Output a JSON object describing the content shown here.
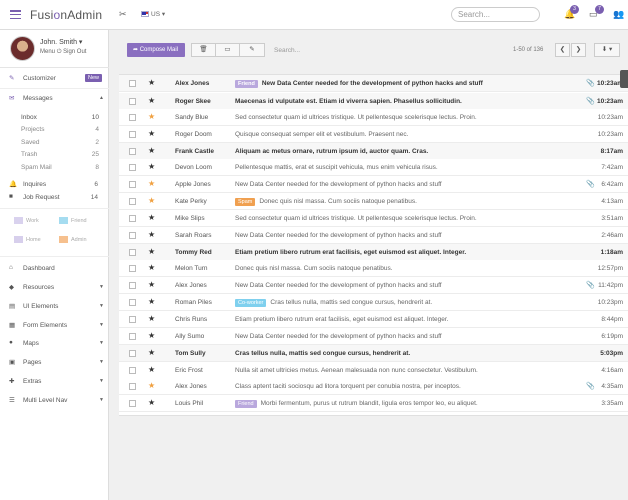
{
  "app": {
    "logo_prefix": "Fusi",
    "logo_accent": "o",
    "logo_suffix": "nAdmin",
    "accent_color": "#7a5fb0"
  },
  "topbar": {
    "language": "US",
    "search_placeholder": "Search...",
    "notifications_count": "3",
    "messages_count": "7"
  },
  "profile": {
    "name": "John. Smith",
    "menu": "Menu",
    "signout": "Sign Out"
  },
  "sidebar": {
    "customizer": "Customizer",
    "customizer_badge": "New",
    "messages": "Messages",
    "folders": [
      {
        "label": "Inbox",
        "count": "10"
      },
      {
        "label": "Projects",
        "count": "4"
      },
      {
        "label": "Saved",
        "count": "2"
      },
      {
        "label": "Trash",
        "count": "25"
      },
      {
        "label": "Spam Mail",
        "count": "8"
      }
    ],
    "inquires": {
      "label": "Inquires",
      "count": "6"
    },
    "job_request": {
      "label": "Job Request",
      "count": "14"
    },
    "labels": [
      {
        "label": "Work",
        "color": "#d9d2ee"
      },
      {
        "label": "Friend",
        "color": "#a5dcf0"
      },
      {
        "label": "Home",
        "color": "#d7cfec"
      },
      {
        "label": "Admin",
        "color": "#f6c08e"
      }
    ],
    "nav": [
      {
        "label": "Dashboard",
        "icon": "home-icon"
      },
      {
        "label": "Resources",
        "icon": "tag-icon"
      },
      {
        "label": "UI Elements",
        "icon": "layers-icon"
      },
      {
        "label": "Form Elements",
        "icon": "form-icon"
      },
      {
        "label": "Maps",
        "icon": "map-marker-icon"
      },
      {
        "label": "Pages",
        "icon": "pages-icon"
      },
      {
        "label": "Extras",
        "icon": "extras-icon"
      },
      {
        "label": "Multi Level Nav",
        "icon": "nav-icon"
      }
    ]
  },
  "mail": {
    "compose_label": "Compose Mail",
    "search_placeholder": "Search...",
    "pager": "1-50 of 136",
    "rows": [
      {
        "from": "Alex Jones",
        "tag": "Friend",
        "tag_color": "#b9a8dd",
        "subject": "New Data Center needed for the development of python hacks and stuff",
        "time": "10:23am",
        "unread": true,
        "starred": false,
        "attach": true
      },
      {
        "from": "Roger Skee",
        "tag": "",
        "subject": "Maecenas id vulputate est. Etiam id viverra sapien. Phasellus sollicitudin.",
        "time": "10:23am",
        "unread": true,
        "starred": false,
        "attach": true
      },
      {
        "from": "Sandy Blue",
        "tag": "",
        "subject": "Sed consectetur quam id ultrices tristique. Ut pellentesque scelerisque lectus. Proin.",
        "time": "10:23am",
        "unread": false,
        "starred": true,
        "attach": false
      },
      {
        "from": "Roger Doom",
        "tag": "",
        "subject": "Quisque consequat semper elit et vestibulum. Praesent nec.",
        "time": "10:23am",
        "unread": false,
        "starred": false,
        "attach": false
      },
      {
        "from": "Frank Castle",
        "tag": "",
        "subject": "Aliquam ac metus ornare, rutrum ipsum id, auctor quam. Cras.",
        "time": "8:17am",
        "unread": true,
        "starred": false,
        "attach": false
      },
      {
        "from": "Devon Loom",
        "tag": "",
        "subject": "Pellentesque mattis, erat et suscipit vehicula, mus enim vehicula risus.",
        "time": "7:42am",
        "unread": false,
        "starred": false,
        "attach": false
      },
      {
        "from": "Apple Jones",
        "tag": "",
        "subject": "New Data Center needed for the development of python hacks and stuff",
        "time": "6:42am",
        "unread": false,
        "starred": true,
        "attach": true
      },
      {
        "from": "Kate Perky",
        "tag": "Spam",
        "tag_color": "#f0a050",
        "subject": "Donec quis nisl massa. Cum sociis natoque penatibus.",
        "time": "4:13am",
        "unread": false,
        "starred": true,
        "attach": false
      },
      {
        "from": "Mike Slips",
        "tag": "",
        "subject": "Sed consectetur quam id ultrices tristique. Ut pellentesque scelerisque lectus. Proin.",
        "time": "3:51am",
        "unread": false,
        "starred": false,
        "attach": false
      },
      {
        "from": "Sarah Roars",
        "tag": "",
        "subject": "New Data Center needed for the development of python hacks and stuff",
        "time": "2:46am",
        "unread": false,
        "starred": false,
        "attach": false
      },
      {
        "from": "Tommy Red",
        "tag": "",
        "subject": "Etiam pretium libero rutrum erat facilisis, eget euismod est aliquet. Integer.",
        "time": "1:18am",
        "unread": true,
        "starred": false,
        "attach": false
      },
      {
        "from": "Melon Turn",
        "tag": "",
        "subject": "Donec quis nisl massa. Cum sociis natoque penatibus.",
        "time": "12:57pm",
        "unread": false,
        "starred": false,
        "attach": false
      },
      {
        "from": "Alex Jones",
        "tag": "",
        "subject": "New Data Center needed for the development of python hacks and stuff",
        "time": "11:42pm",
        "unread": false,
        "starred": false,
        "attach": true
      },
      {
        "from": "Roman Piles",
        "tag": "Co-worker",
        "tag_color": "#7fd0ee",
        "subject": "Cras tellus nulla, mattis sed congue cursus, hendrerit at.",
        "time": "10:23pm",
        "unread": false,
        "starred": false,
        "attach": false
      },
      {
        "from": "Chris Runs",
        "tag": "",
        "subject": "Etiam pretium libero rutrum erat facilisis, eget euismod est aliquet. Integer.",
        "time": "8:44pm",
        "unread": false,
        "starred": false,
        "attach": false
      },
      {
        "from": "Ally Sumo",
        "tag": "",
        "subject": "New Data Center needed for the development of python hacks and stuff",
        "time": "6:19pm",
        "unread": false,
        "starred": false,
        "attach": false
      },
      {
        "from": "Tom Sully",
        "tag": "",
        "subject": "Cras tellus nulla, mattis sed congue cursus, hendrerit at.",
        "time": "5:03pm",
        "unread": true,
        "starred": false,
        "attach": false
      },
      {
        "from": "Eric Frost",
        "tag": "",
        "subject": "Nulla sit amet ultricies metus. Aenean malesuada non nunc consectetur. Vestibulum.",
        "time": "4:16am",
        "unread": false,
        "starred": false,
        "attach": false
      },
      {
        "from": "Alex Jones",
        "tag": "",
        "subject": "Class aptent taciti sociosqu ad litora torquent per conubia nostra, per inceptos.",
        "time": "4:35am",
        "unread": false,
        "starred": true,
        "attach": true
      },
      {
        "from": "Louis Phil",
        "tag": "Friend",
        "tag_color": "#b9a8dd",
        "subject": "Morbi fermentum, purus ut rutrum blandit, ligula eros tempor leo, eu aliquet.",
        "time": "3:35am",
        "unread": false,
        "starred": false,
        "attach": false
      }
    ]
  }
}
